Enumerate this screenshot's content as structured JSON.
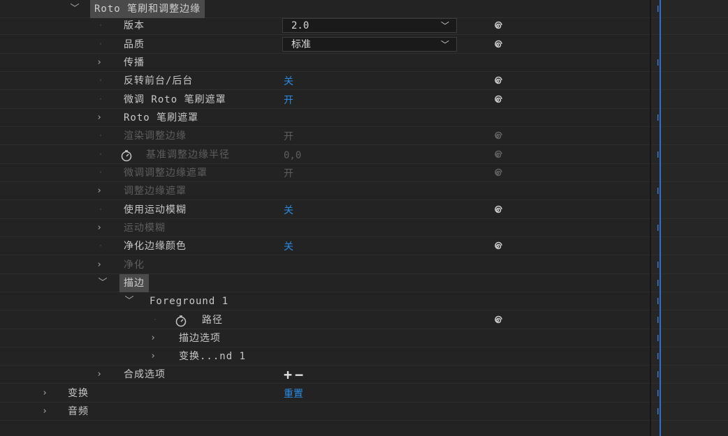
{
  "rows": [
    {
      "label": "Roto 笔刷和调整边缘",
      "twisty": "open",
      "sel": true
    },
    {
      "label": "版本",
      "dropdown": "2.0",
      "spiral": true
    },
    {
      "label": "品质",
      "dropdown": "标准",
      "spiral": true
    },
    {
      "label": "传播",
      "twisty": "closed"
    },
    {
      "label": "反转前台/后台",
      "value": "关",
      "spiral": true
    },
    {
      "label": "微调 Roto 笔刷遮罩",
      "value": "开",
      "spiral": true
    },
    {
      "label": "Roto 笔刷遮罩",
      "twisty": "closed"
    },
    {
      "label": "渲染调整边缘",
      "value": "开",
      "spiral": true,
      "dim": true
    },
    {
      "label": "基准调整边缘半径",
      "value": "0,0",
      "spiral": true,
      "dim": true,
      "stopwatch": true
    },
    {
      "label": "微调调整边缘遮罩",
      "value": "开",
      "spiral": true,
      "dim": true
    },
    {
      "label": "调整边缘遮罩",
      "twisty": "closed",
      "dim": true
    },
    {
      "label": "使用运动模糊",
      "value": "关",
      "spiral": true
    },
    {
      "label": "运动模糊",
      "twisty": "closed",
      "dim": true
    },
    {
      "label": "净化边缘颜色",
      "value": "关",
      "spiral": true
    },
    {
      "label": "净化",
      "twisty": "closed",
      "dim": true
    },
    {
      "label": "描边",
      "twisty": "open",
      "sel": true
    },
    {
      "label": "Foreground 1",
      "twisty": "open"
    },
    {
      "label": "路径",
      "spiral": true,
      "stopwatch": true
    },
    {
      "label": "描边选项",
      "twisty": "closed"
    },
    {
      "label": "变换...nd 1",
      "twisty": "closed"
    },
    {
      "label": "合成选项",
      "twisty": "closed",
      "plusminus": [
        "+",
        "−"
      ]
    },
    {
      "label": "变换",
      "twisty": "closed",
      "value": "重置"
    },
    {
      "label": "音频",
      "twisty": "closed"
    }
  ],
  "icons": {
    "twisty_open": "﹀",
    "twisty_closed": "›",
    "keyframe": "I",
    "spiral": "spiral-icon",
    "stopwatch": "stopwatch-icon",
    "dropdown": "chevron-down-icon"
  },
  "colors": {
    "accent": "#2b8ae0",
    "playhead": "#2f6fd0",
    "background": "#232323",
    "text": "#c8c8c8",
    "dim_text": "#5e5e5e"
  }
}
